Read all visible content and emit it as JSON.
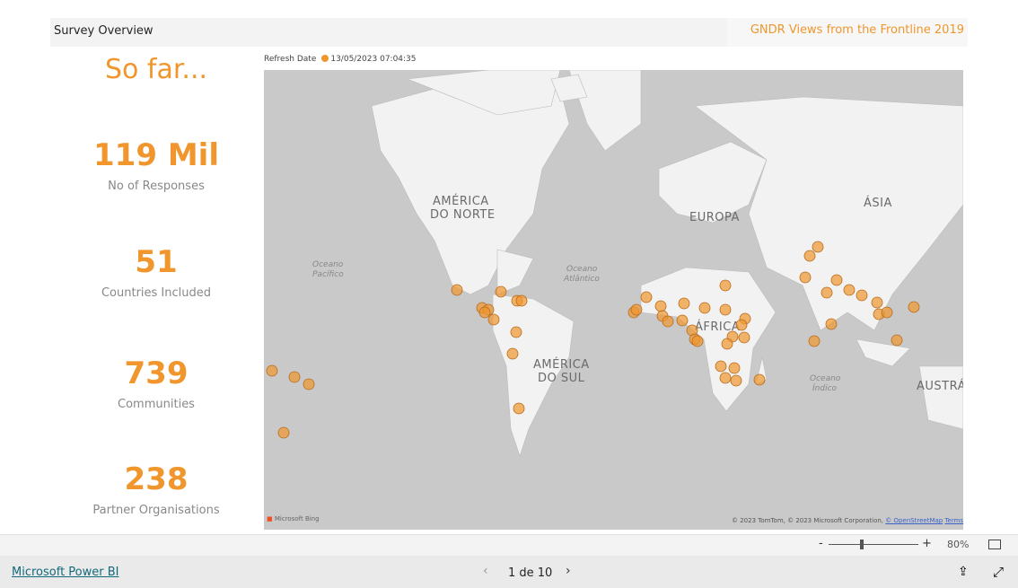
{
  "header": {
    "title": "Survey Overview",
    "report_title": "GNDR Views from the Frontline 2019"
  },
  "kpis": {
    "heading": "So far...",
    "items": [
      {
        "value": "119 Mil",
        "label": "No of Responses"
      },
      {
        "value": "51",
        "label": "Countries Included"
      },
      {
        "value": "739",
        "label": "Communities"
      },
      {
        "value": "238",
        "label": "Partner Organisations"
      }
    ]
  },
  "refresh": {
    "label": "Refresh Date",
    "value": "13/05/2023 07:04:35"
  },
  "map": {
    "labels": [
      "AMÉRICA",
      "DO NORTE",
      "EUROPA",
      "ÁSIA",
      "ÁFRICA",
      "AMÉRICA",
      "DO SUL",
      "AUSTRÁ"
    ],
    "oceans": [
      "Oceano",
      "Pacífico",
      "Oceano",
      "Atlântico",
      "Oceano",
      "Índico"
    ],
    "bubble_color": "#f0962d",
    "land_color": "#f2f2f2",
    "water_color": "#c9c9c9",
    "attribution": "© 2023 TomTom, © 2023 Microsoft Corporation,",
    "osm": "© OpenStreetMap",
    "terms": "Terms",
    "bing": "Microsoft Bing"
  },
  "zoom": {
    "minus": "-",
    "plus": "+",
    "level": "80%",
    "level_fraction": 0.5
  },
  "footer": {
    "brand": "Microsoft Power BI",
    "page": "1 de 10"
  },
  "icons": [
    "share-icon",
    "expand-icon",
    "fit-page-icon",
    "chevron-left-icon",
    "chevron-right-icon"
  ]
}
